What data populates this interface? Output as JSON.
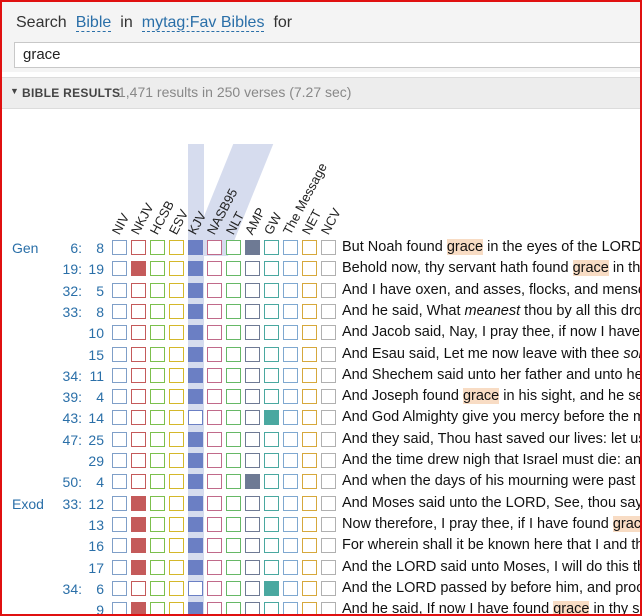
{
  "search": {
    "prefix": "Search",
    "scope": "Bible",
    "in_label": "in",
    "collection": "mytag:Fav Bibles",
    "for_label": "for",
    "query": "grace"
  },
  "results_header": {
    "title": "BIBLE RESULTS",
    "stats": "1,471 results in 250 verses (7.27 sec)"
  },
  "columns": [
    {
      "label": "NIV",
      "color": "#7f9fc8"
    },
    {
      "label": "NKJV",
      "color": "#c45a5a"
    },
    {
      "label": "HCSB",
      "color": "#7cbf4c"
    },
    {
      "label": "ESV",
      "color": "#d4b82a"
    },
    {
      "label": "KJV",
      "color": "#6b7fc4"
    },
    {
      "label": "NASB95",
      "color": "#c06a8a"
    },
    {
      "label": "NLT",
      "color": "#66b866"
    },
    {
      "label": "AMP",
      "color": "#6e7a94"
    },
    {
      "label": "GW",
      "color": "#4aa8a0"
    },
    {
      "label": "The Message",
      "color": "#7fa8d0"
    },
    {
      "label": "NET",
      "color": "#d6a83c"
    },
    {
      "label": "NCV",
      "color": "#b0b0b0"
    }
  ],
  "rows": [
    {
      "book": "Gen",
      "chapter": "6:",
      "verse": "8",
      "hits": [
        0,
        0,
        0,
        0,
        1,
        0,
        0,
        1,
        0,
        0,
        0,
        0
      ],
      "text": [
        [
          "But Noah found ",
          0
        ],
        [
          "grace",
          1
        ],
        [
          " in the eyes of the LORD.",
          0
        ]
      ]
    },
    {
      "book": "",
      "chapter": "19:",
      "verse": "19",
      "hits": [
        0,
        1,
        0,
        0,
        1,
        0,
        0,
        0,
        0,
        0,
        0,
        0
      ],
      "text": [
        [
          "Behold now, thy servant hath found ",
          0
        ],
        [
          "grace",
          1
        ],
        [
          " in thy sight",
          0
        ]
      ]
    },
    {
      "book": "",
      "chapter": "32:",
      "verse": "5",
      "hits": [
        0,
        0,
        0,
        0,
        1,
        0,
        0,
        0,
        0,
        0,
        0,
        0
      ],
      "text": [
        [
          "And I have oxen, and asses, flocks, and menservants",
          0
        ]
      ]
    },
    {
      "book": "",
      "chapter": "33:",
      "verse": "8",
      "hits": [
        0,
        0,
        0,
        0,
        1,
        0,
        0,
        0,
        0,
        0,
        0,
        0
      ],
      "text": [
        [
          "And he said, What ",
          0
        ],
        [
          "meanest",
          2
        ],
        [
          " thou by all this drove",
          0
        ]
      ]
    },
    {
      "book": "",
      "chapter": "",
      "verse": "10",
      "hits": [
        0,
        0,
        0,
        0,
        1,
        0,
        0,
        0,
        0,
        0,
        0,
        0
      ],
      "text": [
        [
          "And Jacob said, Nay, I pray thee, if now I have found",
          0
        ]
      ]
    },
    {
      "book": "",
      "chapter": "",
      "verse": "15",
      "hits": [
        0,
        0,
        0,
        0,
        1,
        0,
        0,
        0,
        0,
        0,
        0,
        0
      ],
      "text": [
        [
          "And Esau said, Let me now leave with thee ",
          0
        ],
        [
          "some",
          2
        ]
      ]
    },
    {
      "book": "",
      "chapter": "34:",
      "verse": "11",
      "hits": [
        0,
        0,
        0,
        0,
        1,
        0,
        0,
        0,
        0,
        0,
        0,
        0
      ],
      "text": [
        [
          "And Shechem said unto her father and unto her",
          0
        ]
      ]
    },
    {
      "book": "",
      "chapter": "39:",
      "verse": "4",
      "hits": [
        0,
        0,
        0,
        0,
        1,
        0,
        0,
        0,
        0,
        0,
        0,
        0
      ],
      "text": [
        [
          "And Joseph found ",
          0
        ],
        [
          "grace",
          1
        ],
        [
          " in his sight, and he served",
          0
        ]
      ]
    },
    {
      "book": "",
      "chapter": "43:",
      "verse": "14",
      "hits": [
        0,
        0,
        0,
        0,
        0,
        0,
        0,
        0,
        1,
        0,
        0,
        0
      ],
      "text": [
        [
          "And God Almighty give you mercy before the man",
          0
        ]
      ]
    },
    {
      "book": "",
      "chapter": "47:",
      "verse": "25",
      "hits": [
        0,
        0,
        0,
        0,
        1,
        0,
        0,
        0,
        0,
        0,
        0,
        0
      ],
      "text": [
        [
          "And they said, Thou hast saved our lives: let us",
          0
        ]
      ]
    },
    {
      "book": "",
      "chapter": "",
      "verse": "29",
      "hits": [
        0,
        0,
        0,
        0,
        1,
        0,
        0,
        0,
        0,
        0,
        0,
        0
      ],
      "text": [
        [
          "And the time drew nigh that Israel must die: and",
          0
        ]
      ]
    },
    {
      "book": "",
      "chapter": "50:",
      "verse": "4",
      "hits": [
        0,
        0,
        0,
        0,
        1,
        0,
        0,
        1,
        0,
        0,
        0,
        0
      ],
      "text": [
        [
          "And when the days of his mourning were past",
          0
        ]
      ]
    },
    {
      "book": "Exod",
      "chapter": "33:",
      "verse": "12",
      "hits": [
        0,
        1,
        0,
        0,
        1,
        0,
        0,
        0,
        0,
        0,
        0,
        0
      ],
      "text": [
        [
          "And Moses said unto the LORD, See, thou sayest",
          0
        ]
      ]
    },
    {
      "book": "",
      "chapter": "",
      "verse": "13",
      "hits": [
        0,
        1,
        0,
        0,
        1,
        0,
        0,
        0,
        0,
        0,
        0,
        0
      ],
      "text": [
        [
          "Now therefore, I pray thee, if I have found ",
          0
        ],
        [
          "grace",
          1
        ]
      ]
    },
    {
      "book": "",
      "chapter": "",
      "verse": "16",
      "hits": [
        0,
        1,
        0,
        0,
        1,
        0,
        0,
        0,
        0,
        0,
        0,
        0
      ],
      "text": [
        [
          "For wherein shall it be known here that I and thy",
          0
        ]
      ]
    },
    {
      "book": "",
      "chapter": "",
      "verse": "17",
      "hits": [
        0,
        1,
        0,
        0,
        1,
        0,
        0,
        0,
        0,
        0,
        0,
        0
      ],
      "text": [
        [
          "And the LORD said unto Moses, I will do this thing",
          0
        ]
      ]
    },
    {
      "book": "",
      "chapter": "34:",
      "verse": "6",
      "hits": [
        0,
        0,
        0,
        0,
        0,
        0,
        0,
        0,
        1,
        0,
        0,
        0
      ],
      "text": [
        [
          "And the LORD passed by before him, and proclaimed",
          0
        ]
      ]
    },
    {
      "book": "",
      "chapter": "",
      "verse": "9",
      "hits": [
        0,
        1,
        0,
        0,
        1,
        0,
        0,
        0,
        0,
        0,
        0,
        0
      ],
      "text": [
        [
          "And he said, If now I have found ",
          0
        ],
        [
          "grace",
          1
        ],
        [
          " in thy sight",
          0
        ]
      ]
    }
  ]
}
